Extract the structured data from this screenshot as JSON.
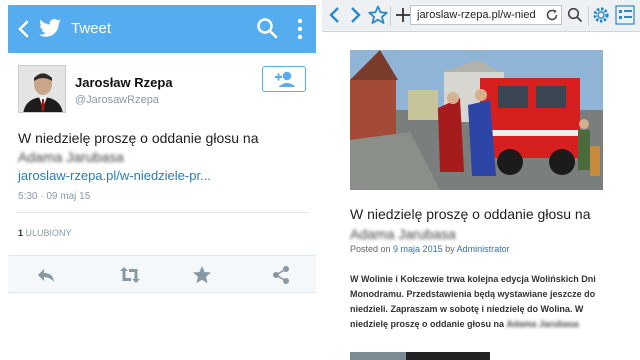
{
  "twitter": {
    "header_title": "Tweet",
    "author_name": "Jarosław Rzepa",
    "author_handle": "@JarosawRzepa",
    "tweet_text_line1": "W niedzielę proszę o oddanie głosu na",
    "tweet_text_blurred": "Adama Jarubasa",
    "tweet_link": "jaroslaw-rzepa.pl/w-niedziele-pr...",
    "tweet_time": "5:30 · 09 maj 15",
    "favorites_count": "1",
    "favorites_label": "ULUBIONY",
    "brand_color": "#55acee",
    "icons": [
      "back-icon",
      "twitter-bird-icon",
      "search-icon",
      "more-icon",
      "follow-icon",
      "reply-icon",
      "retweet-icon",
      "favorite-icon",
      "share-icon"
    ]
  },
  "browser": {
    "url": "jaroslaw-rzepa.pl/w-nied",
    "icons": [
      "back-icon",
      "forward-icon",
      "bookmark-star-icon",
      "new-tab-icon",
      "reload-icon",
      "search-icon",
      "settings-icon",
      "menu-icon"
    ],
    "post_title_line1": "W niedzielę proszę o oddanie głosu na",
    "post_title_blurred": "Adama Jarubasa",
    "meta_prefix": "Posted on",
    "meta_date": "9 maja 2015",
    "meta_by": "by",
    "meta_author": "Administrator",
    "body_main": "W Wolinie i Kołczewie trwa kolejna edycja Wolińskich Dni Monodramu. Przedstawienia będą wystawiane jeszcze do niedzieli. Zapraszam w sobotę i niedzielę do Wolina. W niedzielę proszę o oddanie głosu na",
    "body_blurred": "Adama Jarubasa"
  }
}
